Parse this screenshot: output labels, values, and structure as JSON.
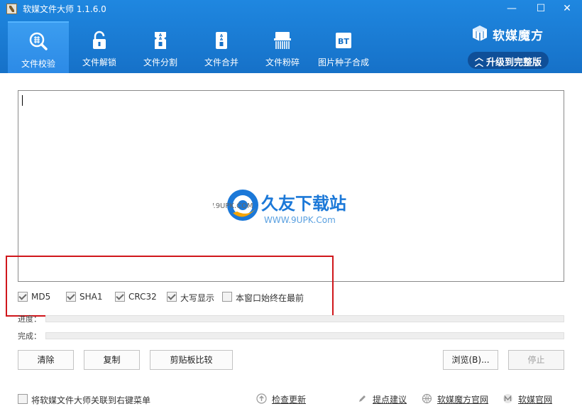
{
  "window": {
    "title": "软媒文件大师 1.1.6.0",
    "minimize": "—",
    "maximize": "☐",
    "close": "✕"
  },
  "tabs": [
    {
      "label": "文件校验",
      "icon": "magnifier-hash-icon",
      "active": true
    },
    {
      "label": "文件解锁",
      "icon": "unlock-icon",
      "active": false
    },
    {
      "label": "文件分割",
      "icon": "zip-split-icon",
      "active": false
    },
    {
      "label": "文件合并",
      "icon": "zip-merge-icon",
      "active": false
    },
    {
      "label": "文件粉碎",
      "icon": "shredder-icon",
      "active": false
    },
    {
      "label": "图片种子合成",
      "icon": "bt-icon",
      "active": false
    }
  ],
  "brand": {
    "name": "软媒魔方",
    "upgrade_label": "升级到完整版"
  },
  "watermark": {
    "title": "久友下载站",
    "url_left": "WWW.9UPK.COM",
    "url_sub": "WWW.9UPK.Com"
  },
  "options": [
    {
      "label": "MD5",
      "checked": true
    },
    {
      "label": "SHA1",
      "checked": true
    },
    {
      "label": "CRC32",
      "checked": true
    },
    {
      "label": "大写显示",
      "checked": true
    },
    {
      "label": "本窗口始终在最前",
      "checked": false
    }
  ],
  "progress": {
    "progress_label": "进度：",
    "progress_value": 0,
    "done_label": "完成：",
    "done_value": 0
  },
  "buttons": {
    "clear": "清除",
    "copy": "复制",
    "compare": "剪贴板比较",
    "browse": "浏览(B)...",
    "stop": "停止"
  },
  "footer": {
    "context_menu_label": "将软媒文件大师关联到右键菜单",
    "check_update": "检查更新",
    "feedback": "提点建议",
    "mofang_site": "软媒魔方官网",
    "ruanmei_site": "软媒官网"
  },
  "colors": {
    "header": "#1671c8",
    "active_tab": "#2c8ae6",
    "upgrade_button": "#0f4f98",
    "annotation_frame": "#d0161b"
  }
}
